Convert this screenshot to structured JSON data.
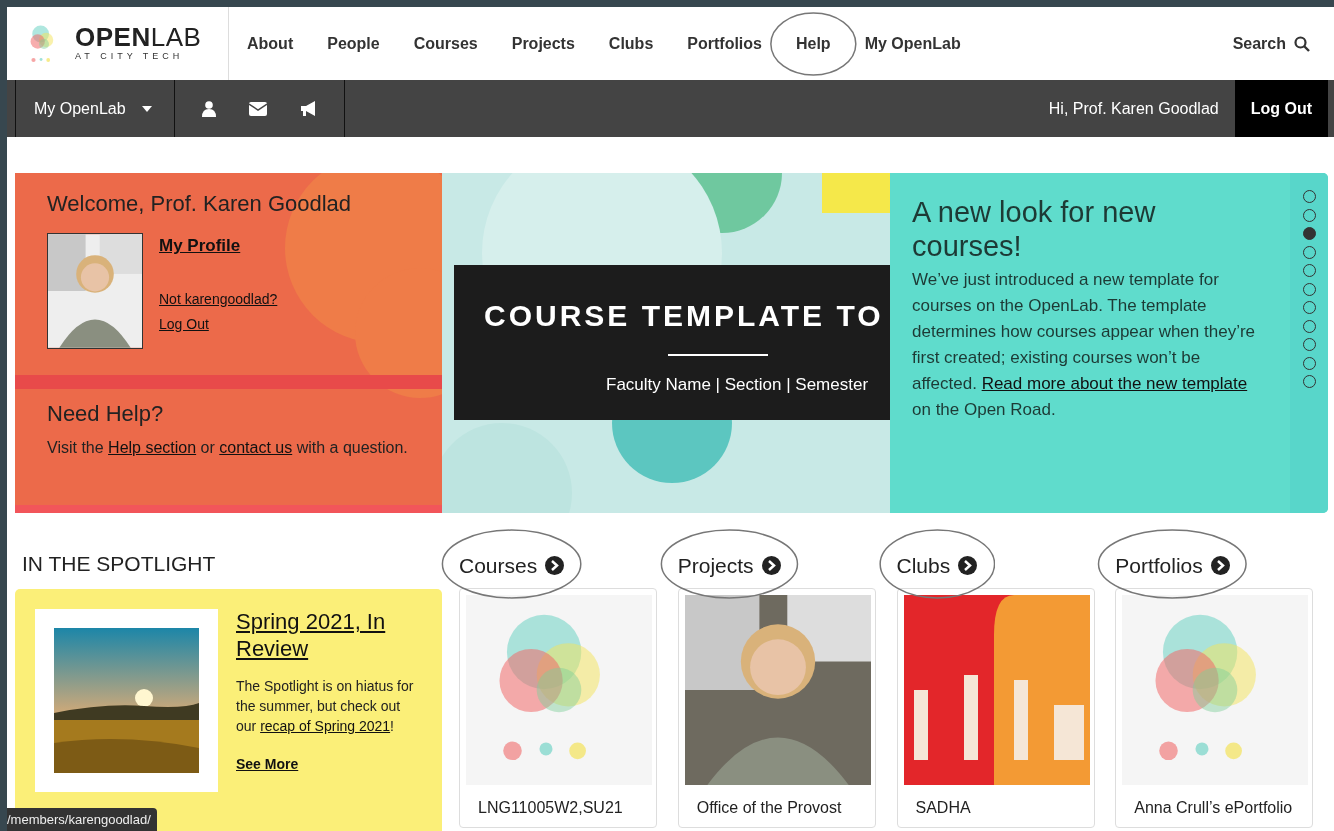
{
  "brand": {
    "name_bold": "OPEN",
    "name_light": "LAB",
    "tagline": "AT CITY TECH"
  },
  "main_nav": [
    {
      "label": "About",
      "circled": false
    },
    {
      "label": "People",
      "circled": false
    },
    {
      "label": "Courses",
      "circled": false
    },
    {
      "label": "Projects",
      "circled": false
    },
    {
      "label": "Clubs",
      "circled": false
    },
    {
      "label": "Portfolios",
      "circled": false
    },
    {
      "label": "Help",
      "circled": true
    },
    {
      "label": "My OpenLab",
      "circled": false
    }
  ],
  "search": {
    "label": "Search"
  },
  "toolbar": {
    "menu_label": "My OpenLab",
    "greeting": "Hi, Prof. Karen Goodlad",
    "logout": "Log Out"
  },
  "welcome": {
    "title": "Welcome, Prof. Karen Goodlad",
    "profile_link": "My Profile",
    "not_user": "Not karengoodlad?",
    "logout": "Log Out"
  },
  "help": {
    "title": "Need Help?",
    "parts": [
      {
        "text": "Visit the ",
        "link": false
      },
      {
        "text": "Help section",
        "link": true
      },
      {
        "text": " or ",
        "link": false
      },
      {
        "text": "contact us",
        "link": true
      },
      {
        "text": " with a question.",
        "link": false
      }
    ]
  },
  "slider": {
    "banner_title": "COURSE TEMPLATE TO",
    "banner_subtitle": "Faculty Name | Section | Semester",
    "heading": "A new look for new courses!",
    "parts": [
      {
        "text": "We’ve just introduced a new template for courses on the OpenLab. The template determines how courses appear when they’re first created; existing courses won’t be affected. ",
        "link": false
      },
      {
        "text": "Read more about the new template",
        "link": true
      },
      {
        "text": " on the Open Road.",
        "link": false
      }
    ],
    "dots": [
      {
        "selected": false
      },
      {
        "selected": false
      },
      {
        "selected": true
      },
      {
        "selected": false
      },
      {
        "selected": false
      },
      {
        "selected": false
      },
      {
        "selected": false
      },
      {
        "selected": false
      },
      {
        "selected": false
      },
      {
        "selected": false
      },
      {
        "selected": false
      }
    ]
  },
  "spotlight": {
    "heading": "IN THE SPOTLIGHT",
    "title": "Spring 2021, In Review",
    "parts": [
      {
        "text": "The Spotlight is on hiatus for the summer, but check out our ",
        "link": false
      },
      {
        "text": "recap of Spring 2021",
        "link": true
      },
      {
        "text": "!",
        "link": false
      }
    ],
    "more": "See More"
  },
  "sections": [
    {
      "label": "Courses",
      "circled": true,
      "card": {
        "title": "LNG11005W2,SU21",
        "kind": "logo"
      }
    },
    {
      "label": "Projects",
      "circled": true,
      "card": {
        "title": "Office of the Provost",
        "kind": "person"
      }
    },
    {
      "label": "Clubs",
      "circled": true,
      "card": {
        "title": "SADHA",
        "kind": "graphic"
      }
    },
    {
      "label": "Portfolios",
      "circled": true,
      "card": {
        "title": "Anna Crull’s ePortfolio",
        "kind": "logo"
      }
    }
  ],
  "status_bar": {
    "url": "/members/karengoodlad/"
  }
}
